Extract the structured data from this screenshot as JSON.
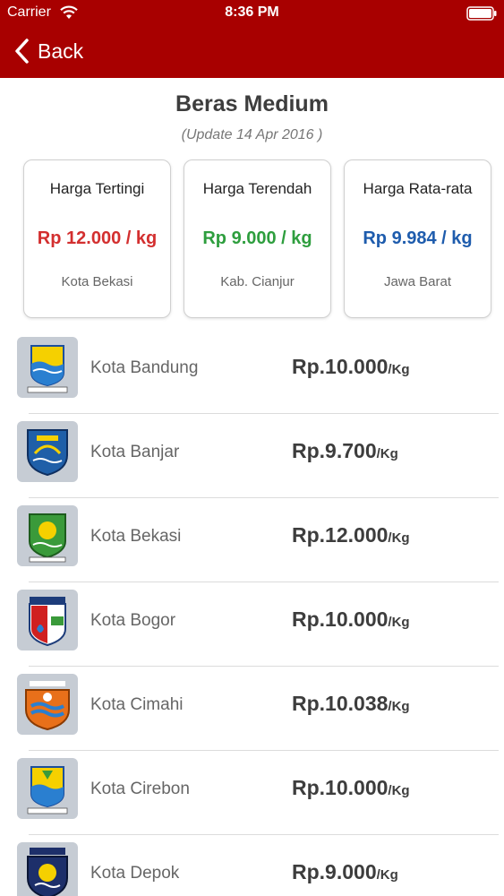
{
  "status_bar": {
    "carrier": "Carrier",
    "time": "8:36 PM"
  },
  "nav": {
    "back_label": "Back"
  },
  "page": {
    "title": "Beras Medium",
    "update": "(Update 14 Apr 2016 )"
  },
  "summary": [
    {
      "label": "Harga Tertingi",
      "price": "Rp 12.000 / kg",
      "region": "Kota Bekasi",
      "color": "#d32f2f"
    },
    {
      "label": "Harga Terendah",
      "price": "Rp 9.000 / kg",
      "region": "Kab. Cianjur",
      "color": "#2e9e3e"
    },
    {
      "label": "Harga Rata-rata",
      "price": "Rp 9.984 / kg",
      "region": "Jawa Barat",
      "color": "#1e5cad"
    }
  ],
  "unit_label": "/Kg",
  "cities": [
    {
      "name": "Kota Bandung",
      "price": "Rp.10.000",
      "logo": "kota-bandung-crest-icon"
    },
    {
      "name": "Kota Banjar",
      "price": "Rp.9.700",
      "logo": "kota-banjar-crest-icon"
    },
    {
      "name": "Kota Bekasi",
      "price": "Rp.12.000",
      "logo": "kota-bekasi-crest-icon"
    },
    {
      "name": "Kota Bogor",
      "price": "Rp.10.000",
      "logo": "kota-bogor-crest-icon"
    },
    {
      "name": "Kota Cimahi",
      "price": "Rp.10.038",
      "logo": "kota-cimahi-crest-icon"
    },
    {
      "name": "Kota Cirebon",
      "price": "Rp.10.000",
      "logo": "kota-cirebon-crest-icon"
    },
    {
      "name": "Kota Depok",
      "price": "Rp.9.000",
      "logo": "kota-depok-crest-icon"
    }
  ],
  "colors": {
    "header": "#a80000",
    "text": "#3d3d3d"
  }
}
